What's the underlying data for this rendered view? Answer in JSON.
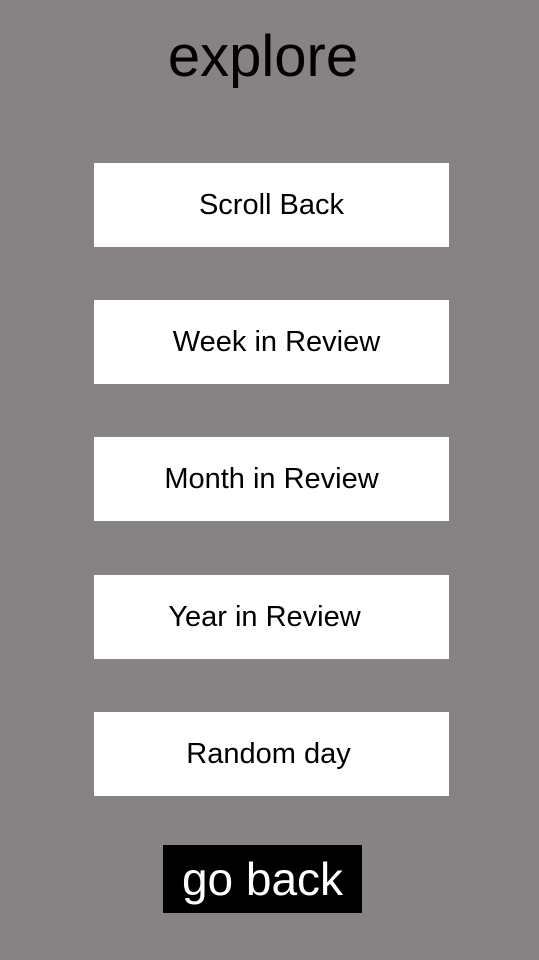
{
  "page": {
    "title": "explore"
  },
  "menu": {
    "items": [
      {
        "label": "Scroll Back"
      },
      {
        "label": "Week in Review"
      },
      {
        "label": "Month in Review"
      },
      {
        "label": "Year in Review"
      },
      {
        "label": "Random day"
      }
    ]
  },
  "footer": {
    "go_back_label": "go back"
  },
  "colors": {
    "background": "#878283",
    "button_background": "#ffffff",
    "button_text": "#000000",
    "go_back_background": "#000000",
    "go_back_text": "#ffffff"
  }
}
